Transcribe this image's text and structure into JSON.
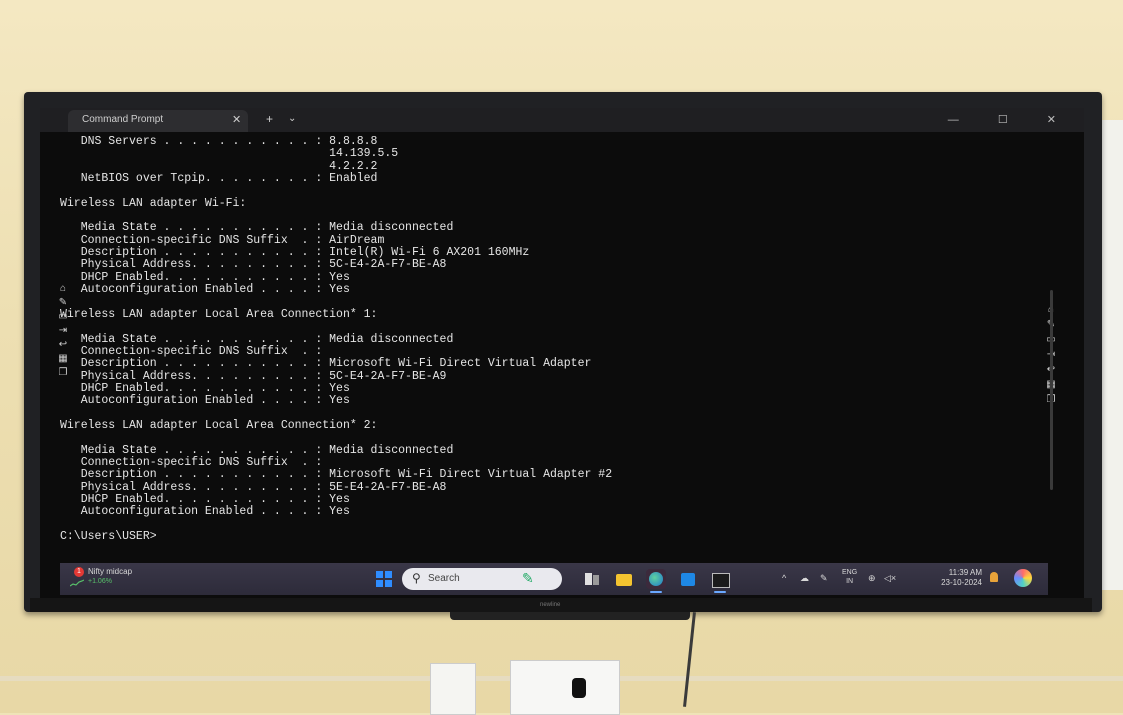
{
  "window": {
    "tab_title": "Command Prompt",
    "tab_close": "✕",
    "tab_add": "+",
    "tab_dropdown": "⌄",
    "controls": "— ☐ ✕"
  },
  "console_lines": [
    "   DNS Servers . . . . . . . . . . . : 8.8.8.8",
    "                                       14.139.5.5",
    "                                       4.2.2.2",
    "   NetBIOS over Tcpip. . . . . . . . : Enabled",
    "",
    "Wireless LAN adapter Wi-Fi:",
    "",
    "   Media State . . . . . . . . . . . : Media disconnected",
    "   Connection-specific DNS Suffix  . : AirDream",
    "   Description . . . . . . . . . . . : Intel(R) Wi-Fi 6 AX201 160MHz",
    "   Physical Address. . . . . . . . . : 5C-E4-2A-F7-BE-A8",
    "   DHCP Enabled. . . . . . . . . . . : Yes",
    "   Autoconfiguration Enabled . . . . : Yes",
    "",
    "Wireless LAN adapter Local Area Connection* 1:",
    "",
    "   Media State . . . . . . . . . . . : Media disconnected",
    "   Connection-specific DNS Suffix  . :",
    "   Description . . . . . . . . . . . : Microsoft Wi-Fi Direct Virtual Adapter",
    "   Physical Address. . . . . . . . . : 5C-E4-2A-F7-BE-A9",
    "   DHCP Enabled. . . . . . . . . . . : Yes",
    "   Autoconfiguration Enabled . . . . : Yes",
    "",
    "Wireless LAN adapter Local Area Connection* 2:",
    "",
    "   Media State . . . . . . . . . . . : Media disconnected",
    "   Connection-specific DNS Suffix  . :",
    "   Description . . . . . . . . . . . : Microsoft Wi-Fi Direct Virtual Adapter #2",
    "   Physical Address. . . . . . . . . : 5E-E4-2A-F7-BE-A8",
    "   DHCP Enabled. . . . . . . . . . . : Yes",
    "   Autoconfiguration Enabled . . . . : Yes",
    "",
    "C:\\Users\\USER>"
  ],
  "overlay_icons": [
    "home-icon",
    "edit-icon",
    "comment-icon",
    "exit-icon",
    "undo-icon",
    "apps-icon",
    "window-icon"
  ],
  "taskbar": {
    "widget_badge": "1",
    "widget_title": "Nifty midcap",
    "widget_value": "+1.06%",
    "search_placeholder": "Search",
    "lang_top": "ENG",
    "lang_bottom": "IN",
    "time": "11:39 AM",
    "date": "23-10-2024"
  },
  "monitor_brand": "newline",
  "colors": {
    "console_bg": "#0c0c0c",
    "console_text": "#e6e6e6",
    "taskbar_bg": "#2d2b3a",
    "accent": "#2f8dff",
    "stock_up": "#58c06a"
  }
}
